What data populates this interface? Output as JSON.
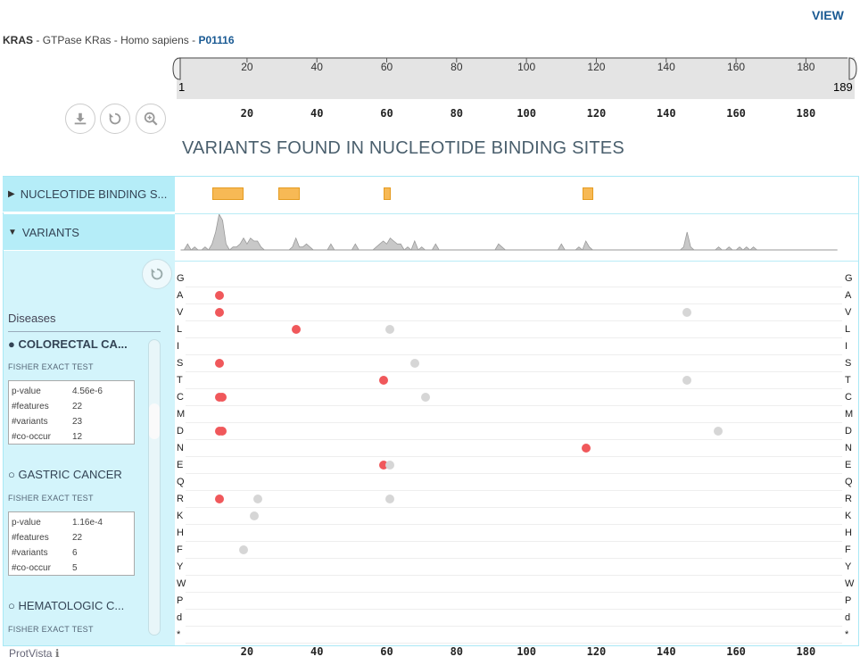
{
  "header": {
    "view_label": "VIEW",
    "gene": "KRAS",
    "sep1": " - ",
    "protein": "GTPase KRas",
    "sep2": " - ",
    "organism": "Homo sapiens",
    "sep3": " - ",
    "accession": "P01116"
  },
  "navigation": {
    "start": "1",
    "end": "189",
    "ticks": [
      "20",
      "40",
      "60",
      "80",
      "100",
      "120",
      "140",
      "160",
      "180"
    ]
  },
  "toolbar": {
    "download_icon": "download-icon",
    "reset_icon": "reset-icon",
    "zoom_icon": "zoom-in-icon"
  },
  "title": "VARIANTS FOUND IN NUCLEOTIDE BINDING SITES",
  "categories": {
    "nucleotide_binding": "NUCLEOTIDE BINDING S...",
    "variants": "VARIANTS"
  },
  "nucleotide_binding_regions": [
    [
      10,
      19
    ],
    [
      29,
      35
    ],
    [
      59,
      60
    ],
    [
      116,
      119
    ]
  ],
  "diseases": {
    "title": "Diseases",
    "items": [
      {
        "marker": "●",
        "name": "COLORECTAL CA...",
        "test": "FISHER EXACT TEST",
        "stats": [
          {
            "key": "p-value",
            "value": "4.56e-6"
          },
          {
            "key": "#features",
            "value": "22"
          },
          {
            "key": "#variants",
            "value": "23"
          },
          {
            "key": "#co-occur",
            "value": "12"
          }
        ]
      },
      {
        "marker": "○",
        "name": "GASTRIC CANCER",
        "test": "FISHER EXACT TEST",
        "stats": [
          {
            "key": "p-value",
            "value": "1.16e-4"
          },
          {
            "key": "#features",
            "value": "22"
          },
          {
            "key": "#variants",
            "value": "6"
          },
          {
            "key": "#co-occur",
            "value": "5"
          }
        ]
      },
      {
        "marker": "○",
        "name": "HEMATOLOGIC C...",
        "test": "FISHER EXACT TEST"
      }
    ]
  },
  "amino_acids": [
    "G",
    "A",
    "V",
    "L",
    "I",
    "S",
    "T",
    "C",
    "M",
    "D",
    "N",
    "E",
    "Q",
    "R",
    "K",
    "H",
    "F",
    "Y",
    "W",
    "P",
    "d",
    "*"
  ],
  "variant_points": [
    {
      "pos": 12,
      "aa": "A",
      "status": "disease"
    },
    {
      "pos": 12,
      "aa": "V",
      "status": "disease"
    },
    {
      "pos": 146,
      "aa": "V",
      "status": "other"
    },
    {
      "pos": 34,
      "aa": "L",
      "status": "disease"
    },
    {
      "pos": 61,
      "aa": "L",
      "status": "other"
    },
    {
      "pos": 12,
      "aa": "S",
      "status": "disease"
    },
    {
      "pos": 68,
      "aa": "S",
      "status": "other"
    },
    {
      "pos": 59,
      "aa": "T",
      "status": "disease"
    },
    {
      "pos": 146,
      "aa": "T",
      "status": "other"
    },
    {
      "pos": 12,
      "aa": "C",
      "status": "disease"
    },
    {
      "pos": 13,
      "aa": "C",
      "status": "disease"
    },
    {
      "pos": 71,
      "aa": "C",
      "status": "other"
    },
    {
      "pos": 12,
      "aa": "D",
      "status": "disease"
    },
    {
      "pos": 13,
      "aa": "D",
      "status": "disease"
    },
    {
      "pos": 155,
      "aa": "D",
      "status": "other"
    },
    {
      "pos": 117,
      "aa": "N",
      "status": "disease"
    },
    {
      "pos": 59,
      "aa": "E",
      "status": "disease"
    },
    {
      "pos": 61,
      "aa": "E",
      "status": "other"
    },
    {
      "pos": 12,
      "aa": "R",
      "status": "disease"
    },
    {
      "pos": 23,
      "aa": "R",
      "status": "other"
    },
    {
      "pos": 61,
      "aa": "R",
      "status": "other"
    },
    {
      "pos": 22,
      "aa": "K",
      "status": "other"
    },
    {
      "pos": 19,
      "aa": "F",
      "status": "other"
    }
  ],
  "variant_counts": [
    [
      2,
      0
    ],
    [
      3,
      2
    ],
    [
      5,
      1
    ],
    [
      8,
      1
    ],
    [
      10,
      2
    ],
    [
      11,
      6
    ],
    [
      12,
      12
    ],
    [
      13,
      10
    ],
    [
      14,
      2
    ],
    [
      16,
      1
    ],
    [
      17,
      1
    ],
    [
      18,
      2
    ],
    [
      19,
      4
    ],
    [
      20,
      2
    ],
    [
      21,
      4
    ],
    [
      22,
      3
    ],
    [
      23,
      3
    ],
    [
      24,
      1
    ],
    [
      33,
      1
    ],
    [
      34,
      4
    ],
    [
      35,
      1
    ],
    [
      36,
      1
    ],
    [
      37,
      2
    ],
    [
      38,
      1
    ],
    [
      44,
      2
    ],
    [
      51,
      2
    ],
    [
      57,
      1
    ],
    [
      58,
      2
    ],
    [
      59,
      3
    ],
    [
      60,
      2
    ],
    [
      61,
      4
    ],
    [
      62,
      3
    ],
    [
      63,
      2
    ],
    [
      64,
      2
    ],
    [
      66,
      1
    ],
    [
      68,
      3
    ],
    [
      70,
      1
    ],
    [
      74,
      2
    ],
    [
      92,
      2
    ],
    [
      93,
      1
    ],
    [
      110,
      2
    ],
    [
      115,
      1
    ],
    [
      117,
      3
    ],
    [
      118,
      1
    ],
    [
      145,
      1
    ],
    [
      146,
      6
    ],
    [
      147,
      1
    ],
    [
      155,
      1
    ],
    [
      158,
      1
    ],
    [
      161,
      1
    ],
    [
      163,
      1
    ],
    [
      165,
      1
    ]
  ],
  "colors": {
    "disease": "#f0585b",
    "other": "#d6d6d6",
    "binding_site": "#f7b955",
    "category_bg": "#b5edf8",
    "panel_bg": "#d3f4fb",
    "accent": "#1a5a93"
  },
  "footer": {
    "brand": "ProtVista",
    "info_icon": "info-icon"
  }
}
